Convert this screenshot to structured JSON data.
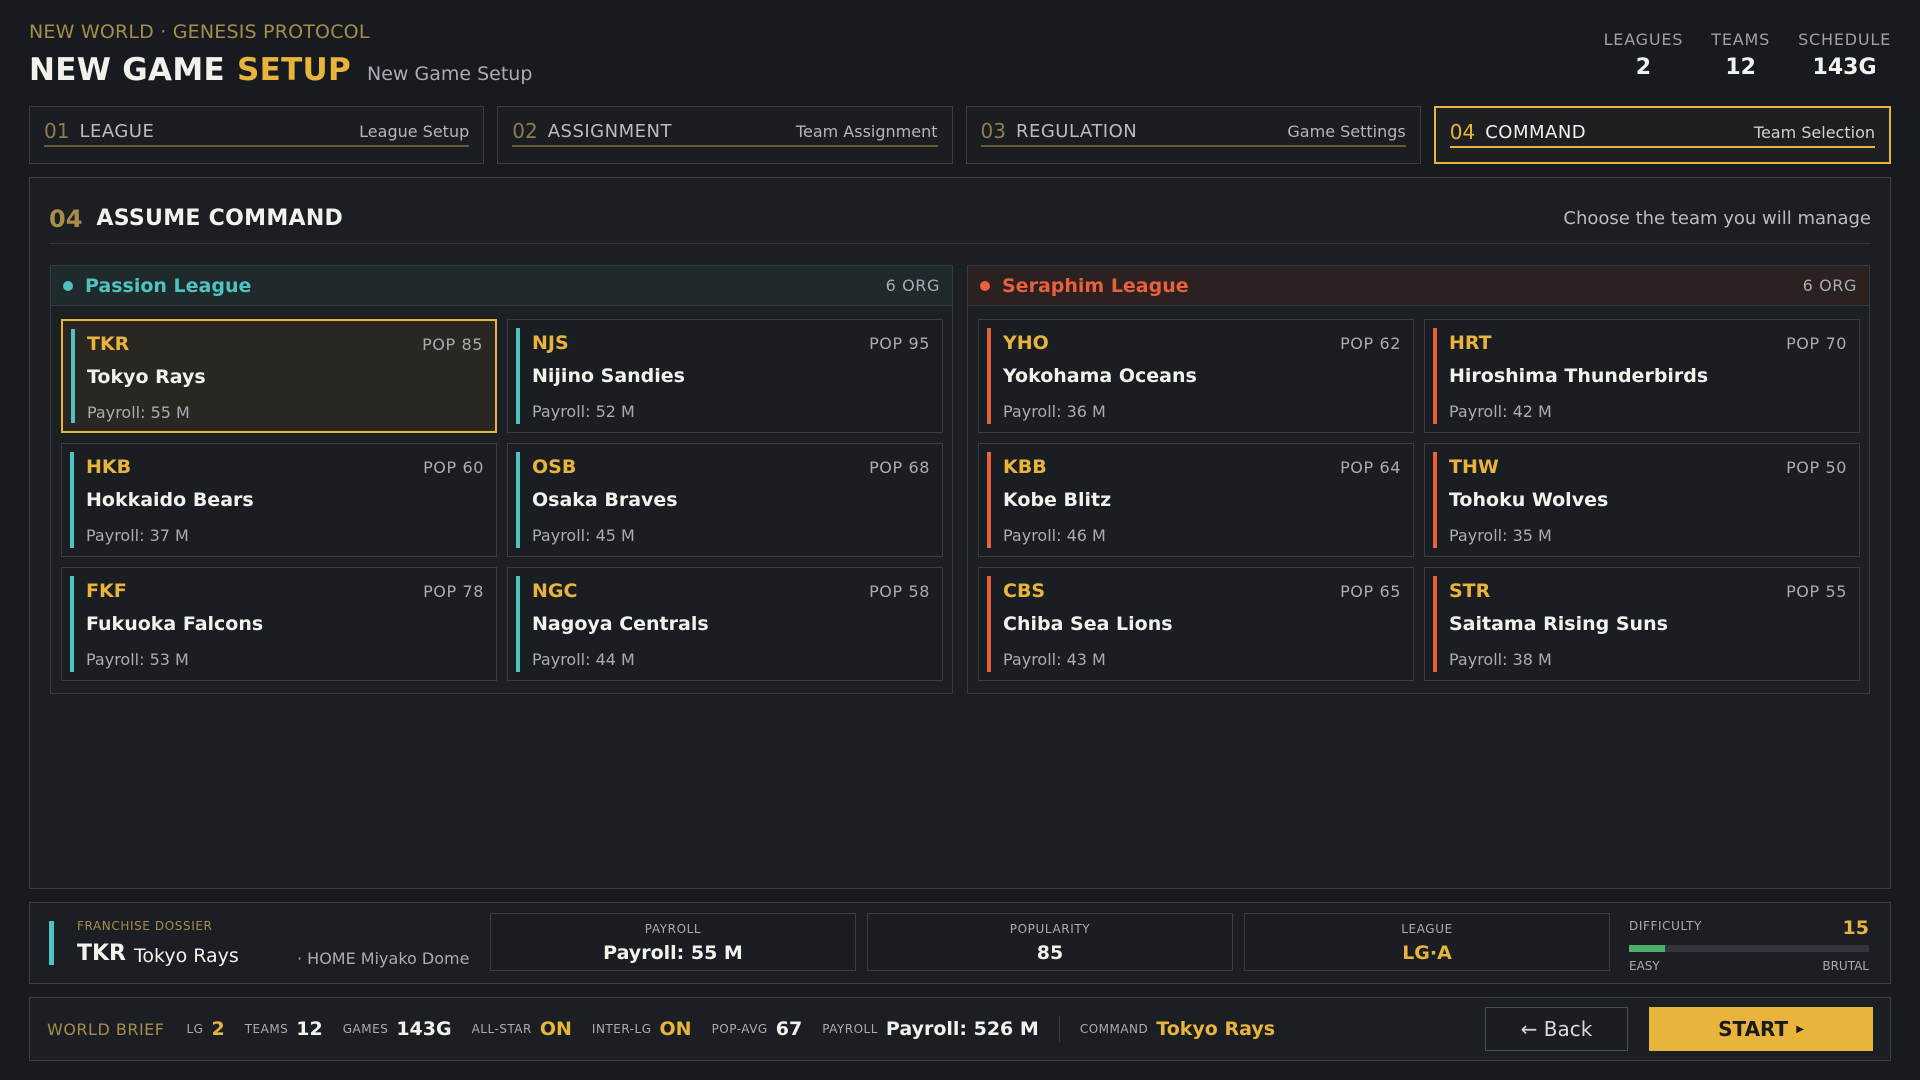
{
  "header": {
    "eyebrow": "NEW WORLD · GENESIS PROTOCOL",
    "title_main": "NEW GAME",
    "title_accent": "SETUP",
    "subtitle": "New Game Setup",
    "stats": [
      {
        "label": "LEAGUES",
        "value": "2"
      },
      {
        "label": "TEAMS",
        "value": "12"
      },
      {
        "label": "SCHEDULE",
        "value": "143G"
      }
    ]
  },
  "steps": [
    {
      "num": "01",
      "label": "LEAGUE",
      "desc": "League Setup"
    },
    {
      "num": "02",
      "label": "ASSIGNMENT",
      "desc": "Team Assignment"
    },
    {
      "num": "03",
      "label": "REGULATION",
      "desc": "Game Settings"
    },
    {
      "num": "04",
      "label": "COMMAND",
      "desc": "Team Selection"
    }
  ],
  "main": {
    "num": "04",
    "title": "ASSUME COMMAND",
    "hint": "Choose the team you will manage"
  },
  "leagues": [
    {
      "name": "Passion League",
      "org": "6 ORG",
      "color": "#4fc3c0",
      "teams": [
        {
          "code": "TKR",
          "pop": "POP 85",
          "name": "Tokyo Rays",
          "payroll": "Payroll: 55 M"
        },
        {
          "code": "NJS",
          "pop": "POP 95",
          "name": "Nijino Sandies",
          "payroll": "Payroll: 52 M"
        },
        {
          "code": "HKB",
          "pop": "POP 60",
          "name": "Hokkaido Bears",
          "payroll": "Payroll: 37 M"
        },
        {
          "code": "OSB",
          "pop": "POP 68",
          "name": "Osaka Braves",
          "payroll": "Payroll: 45 M"
        },
        {
          "code": "FKF",
          "pop": "POP 78",
          "name": "Fukuoka Falcons",
          "payroll": "Payroll: 53 M"
        },
        {
          "code": "NGC",
          "pop": "POP 58",
          "name": "Nagoya Centrals",
          "payroll": "Payroll: 44 M"
        }
      ]
    },
    {
      "name": "Seraphim League",
      "org": "6 ORG",
      "color": "#e8603c",
      "teams": [
        {
          "code": "YHO",
          "pop": "POP 62",
          "name": "Yokohama Oceans",
          "payroll": "Payroll: 36 M"
        },
        {
          "code": "HRT",
          "pop": "POP 70",
          "name": "Hiroshima Thunderbirds",
          "payroll": "Payroll: 42 M"
        },
        {
          "code": "KBB",
          "pop": "POP 64",
          "name": "Kobe Blitz",
          "payroll": "Payroll: 46 M"
        },
        {
          "code": "THW",
          "pop": "POP 50",
          "name": "Tohoku Wolves",
          "payroll": "Payroll: 35 M"
        },
        {
          "code": "CBS",
          "pop": "POP 65",
          "name": "Chiba Sea Lions",
          "payroll": "Payroll: 43 M"
        },
        {
          "code": "STR",
          "pop": "POP 55",
          "name": "Saitama Rising Suns",
          "payroll": "Payroll: 38 M"
        }
      ]
    }
  ],
  "dossier": {
    "label": "FRANCHISE DOSSIER",
    "code": "TKR",
    "name": "Tokyo Rays",
    "home": "· HOME Miyako Dome",
    "payroll_label": "PAYROLL",
    "payroll_value": "Payroll: 55 M",
    "popularity_label": "POPULARITY",
    "popularity_value": "85",
    "league_label": "LEAGUE",
    "league_value": "LG·A",
    "difficulty_label": "DIFFICULTY",
    "difficulty_value": "15",
    "difficulty_fraction": 0.15,
    "easy": "EASY",
    "brutal": "BRUTAL"
  },
  "brief": {
    "title": "WORLD BRIEF",
    "lg_label": "LG",
    "lg_value": "2",
    "teams_label": "TEAMS",
    "teams_value": "12",
    "games_label": "GAMES",
    "games_value": "143G",
    "allstar_label": "ALL-STAR",
    "allstar_value": "ON",
    "interlg_label": "INTER-LG",
    "interlg_value": "ON",
    "popavg_label": "POP-AVG",
    "popavg_value": "67",
    "payroll_label": "PAYROLL",
    "payroll_value": "Payroll: 526 M",
    "command_label": "COMMAND",
    "command_value": "Tokyo Rays"
  },
  "buttons": {
    "back": "← Back",
    "start": "START"
  },
  "colors": {
    "accent": "#e8b43c",
    "passion": "#4fc3c0",
    "seraphim": "#e8603c"
  }
}
